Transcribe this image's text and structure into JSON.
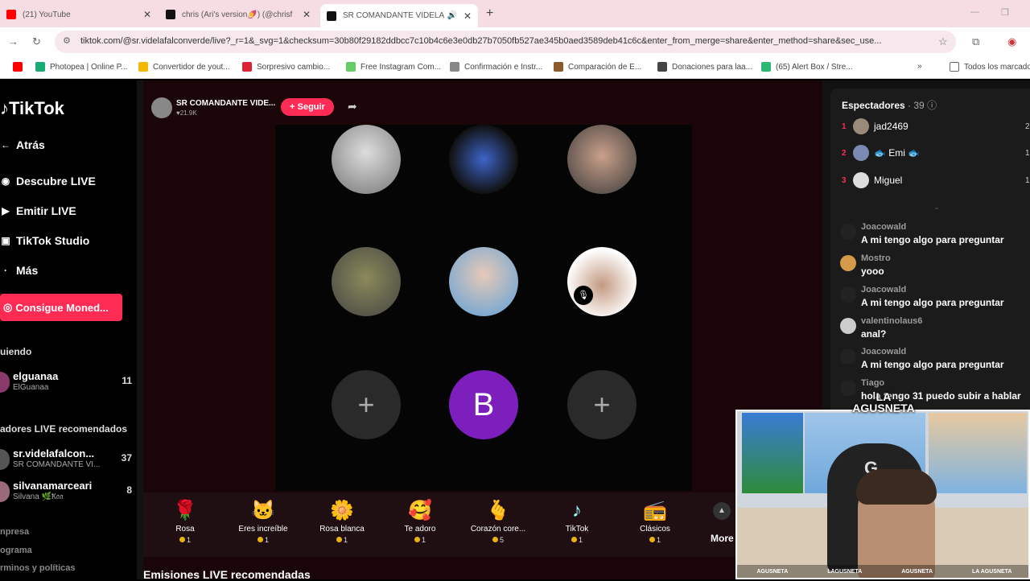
{
  "browser": {
    "tabs": [
      {
        "title": "(21) YouTube",
        "color": "#ff0000"
      },
      {
        "title": "chris (Ari's version🍠) (@chrisf",
        "color": "#111111"
      },
      {
        "title": "SR COMANDANTE VIDELA",
        "color": "#111111"
      }
    ],
    "url": "tiktok.com/@sr.videlafalconverde/live?_r=1&_svg=1&checksum=30b80f29182ddbcc7c10b4c6e3e0db27b7050fb527ae345b0aed3589deb41c6c&enter_from_merge=share&enter_method=share&sec_use...",
    "bookmarks": [
      "Photopea | Online P...",
      "Convertidor de yout...",
      "Sorpresivo cambio...",
      "Free Instagram Com...",
      "Confirmación e Instr...",
      "Comparación de E...",
      "Donaciones para laa...",
      "(65) Alert Box / Stre..."
    ],
    "bookmarks_folder": "Todos los marcado"
  },
  "sidebar": {
    "logo": "TikTok",
    "nav": [
      {
        "label": "Atrás",
        "icon": "back-icon"
      },
      {
        "label": "Descubre LIVE",
        "icon": "live-icon"
      },
      {
        "label": "Emitir LIVE",
        "icon": "camera-icon"
      },
      {
        "label": "TikTok Studio",
        "icon": "studio-icon"
      },
      {
        "label": "Más",
        "icon": "more-icon"
      }
    ],
    "coins_button": "Consigue Moned...",
    "following_label": "uiendo",
    "following": [
      {
        "name": "elguanaa",
        "sub": "ElGuanaa",
        "count": "11"
      }
    ],
    "recommended_label": "adores LIVE recomendados",
    "recommended": [
      {
        "name": "sr.videlafalcon...",
        "sub": "SR COMANDANTE VI...",
        "count": "37"
      },
      {
        "name": "silvanamarceari",
        "sub": "Silvana 🌿Ҟ𝔞𝔞",
        "count": "8"
      }
    ],
    "footer_links": [
      "npresa",
      "ograma",
      "rminos y políticas"
    ]
  },
  "stream": {
    "host_name": "SR COMANDANTE VIDE...",
    "host_likes": "♥21.9K",
    "follow_label": "+ Seguir",
    "empty_slot_symbol": "+",
    "guest_initial": "B",
    "gifts": [
      {
        "name": "Rosa",
        "price": "1",
        "icon": "🌹"
      },
      {
        "name": "Eres increíble",
        "price": "1",
        "icon": "🐱"
      },
      {
        "name": "Rosa blanca",
        "price": "1",
        "icon": "🌼"
      },
      {
        "name": "Te adoro",
        "price": "1",
        "icon": "🥰"
      },
      {
        "name": "Corazón core...",
        "price": "5",
        "icon": "🫰"
      },
      {
        "name": "TikTok",
        "price": "1",
        "icon": "♪"
      },
      {
        "name": "Clásicos",
        "price": "1",
        "icon": "📻"
      }
    ],
    "more_label": "More",
    "recommended_streams_title": "Emisiones LIVE recomendadas"
  },
  "viewers_panel": {
    "title": "Espectadores",
    "count": "· 39",
    "top": [
      {
        "rank": "1",
        "name": "jad2469",
        "extra": "2"
      },
      {
        "rank": "2",
        "name": "🐟 Emi 🐟",
        "extra": "1"
      },
      {
        "rank": "3",
        "name": "Miguel",
        "extra": "1"
      }
    ]
  },
  "chat": [
    {
      "user": "Joacowald",
      "text": "A mi tengo algo para preguntar"
    },
    {
      "user": "Mostro",
      "text": "yooo"
    },
    {
      "user": "Joacowald",
      "text": "A mi tengo algo para preguntar"
    },
    {
      "user": "valentinolaus6",
      "text": "anal?"
    },
    {
      "user": "Joacowald",
      "text": "A mi tengo algo para preguntar"
    },
    {
      "user": "Tiago",
      "text": "hola tengo 31 puedo subir a hablar"
    }
  ],
  "webcam": {
    "brand": "LA AGUSNETA",
    "socials": [
      "AGUSNETA",
      "LAGUSNETA",
      "AGUSNETA",
      "LA AGUSNETA"
    ]
  },
  "colors": {
    "accent": "#fe2c55",
    "guest_purple": "#7c1fbd",
    "coin": "#e8b40c"
  }
}
